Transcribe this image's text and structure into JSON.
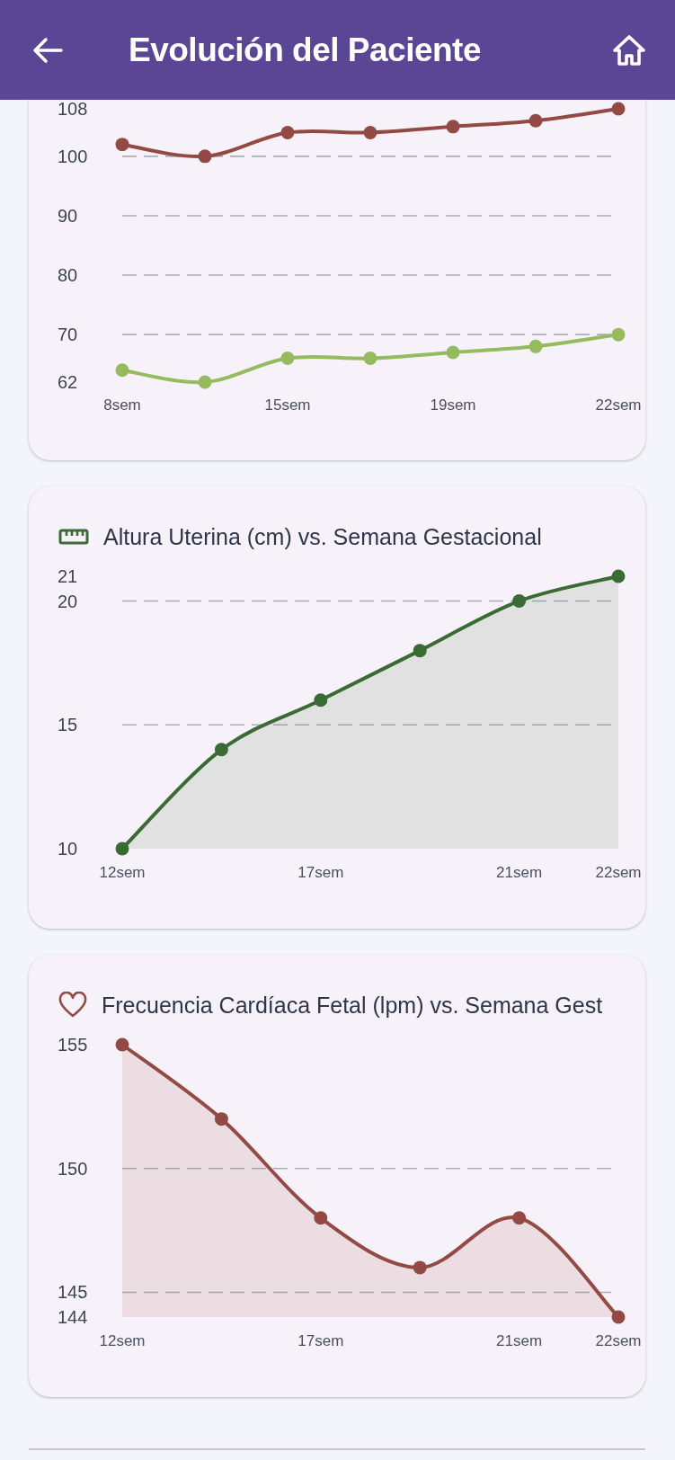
{
  "app_bar": {
    "title": "Evolución del Paciente"
  },
  "cards": [
    {
      "chart_data": {
        "type": "line",
        "categories": [
          "8sem",
          null,
          "15sem",
          null,
          "19sem",
          null,
          "22sem"
        ],
        "ylim": [
          62,
          108
        ],
        "yticks": [
          62,
          70,
          80,
          90,
          100,
          108
        ],
        "grid": true,
        "series": [
          {
            "color": "#944a44",
            "marker": true,
            "values": [
              102,
              100,
              104,
              104,
              105,
              106,
              108
            ]
          },
          {
            "color": "#96bb5f",
            "marker": true,
            "values": [
              64,
              62,
              66,
              66,
              67,
              68,
              70
            ]
          }
        ]
      }
    },
    {
      "chart_data": {
        "type": "area",
        "title": "Altura Uterina (cm) vs. Semana Gestacional",
        "categories": [
          "12sem",
          null,
          "17sem",
          null,
          "21sem",
          "22sem"
        ],
        "ylim": [
          10,
          21
        ],
        "yticks": [
          10,
          15,
          20,
          21
        ],
        "grid": true,
        "series": [
          {
            "color": "#3a6b35",
            "marker": true,
            "values": [
              10,
              14,
              16,
              18,
              20,
              21
            ]
          }
        ]
      }
    },
    {
      "chart_data": {
        "type": "area",
        "title": "Frecuencia Cardíaca Fetal (lpm) vs. Semana Gest",
        "categories": [
          "12sem",
          null,
          "17sem",
          null,
          "21sem",
          "22sem"
        ],
        "ylim": [
          144,
          155
        ],
        "yticks": [
          144,
          145,
          150,
          155
        ],
        "grid": true,
        "series": [
          {
            "color": "#944a44",
            "marker": true,
            "values": [
              155,
              152,
              148,
              146,
              148,
              144
            ]
          }
        ]
      }
    }
  ]
}
